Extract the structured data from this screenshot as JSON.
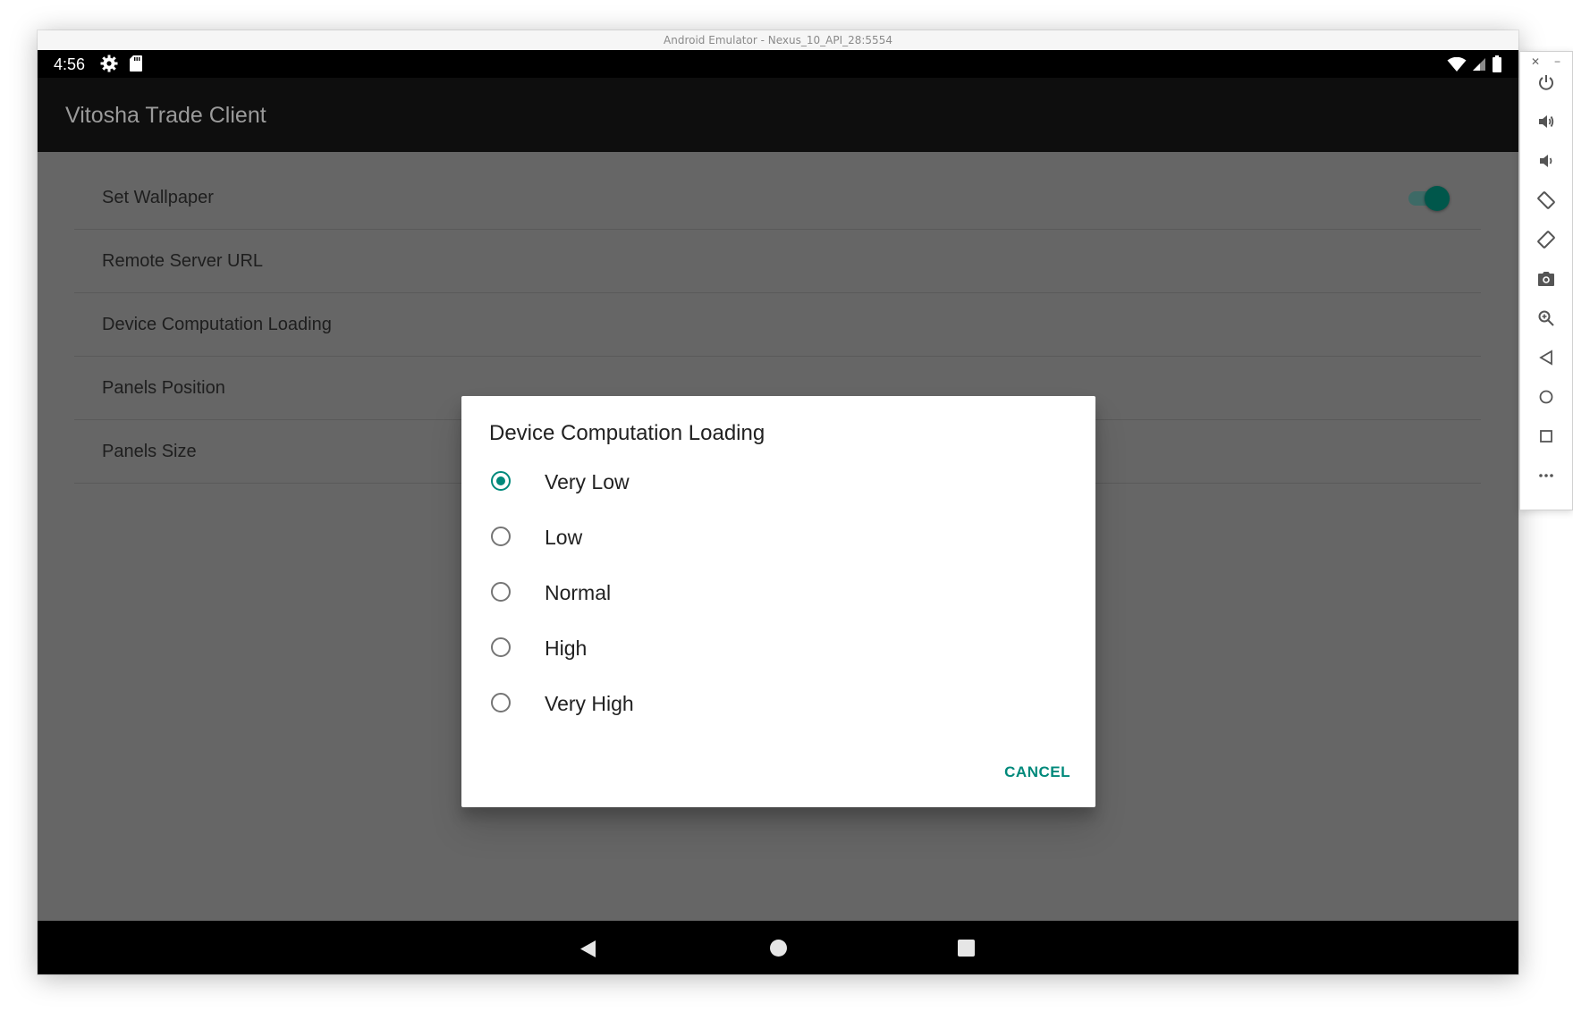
{
  "window": {
    "title": "Android Emulator - Nexus_10_API_28:5554"
  },
  "statusbar": {
    "time": "4:56",
    "icons": [
      "gear-icon",
      "sd-card-icon",
      "wifi-icon",
      "signal-icon",
      "battery-icon"
    ]
  },
  "appbar": {
    "title": "Vitosha Trade Client"
  },
  "preferences": {
    "items": [
      {
        "label": "Set Wallpaper",
        "has_toggle": true,
        "toggle_on": true
      },
      {
        "label": "Remote Server URL"
      },
      {
        "label": "Device Computation Loading"
      },
      {
        "label": "Panels Position"
      },
      {
        "label": "Panels Size"
      }
    ]
  },
  "dialog": {
    "title": "Device Computation Loading",
    "options": [
      {
        "label": "Very Low",
        "checked": true
      },
      {
        "label": "Low",
        "checked": false
      },
      {
        "label": "Normal",
        "checked": false
      },
      {
        "label": "High",
        "checked": false
      },
      {
        "label": "Very High",
        "checked": false
      }
    ],
    "cancel_label": "CANCEL"
  },
  "navbar": {
    "buttons": [
      "back-icon",
      "home-icon",
      "recents-icon"
    ]
  },
  "side_toolbar": {
    "controls": [
      "close-icon",
      "minimize-icon"
    ],
    "buttons": [
      "power-icon",
      "volume-up-icon",
      "volume-down-icon",
      "rotate-left-icon",
      "rotate-right-icon",
      "camera-icon",
      "zoom-icon",
      "back-icon",
      "home-icon",
      "overview-icon",
      "more-icon"
    ]
  },
  "colors": {
    "accent": "#00897b",
    "toggle_thumb": "#00574b",
    "scrim_background": "#666666",
    "appbar": "#0e0e0e"
  }
}
